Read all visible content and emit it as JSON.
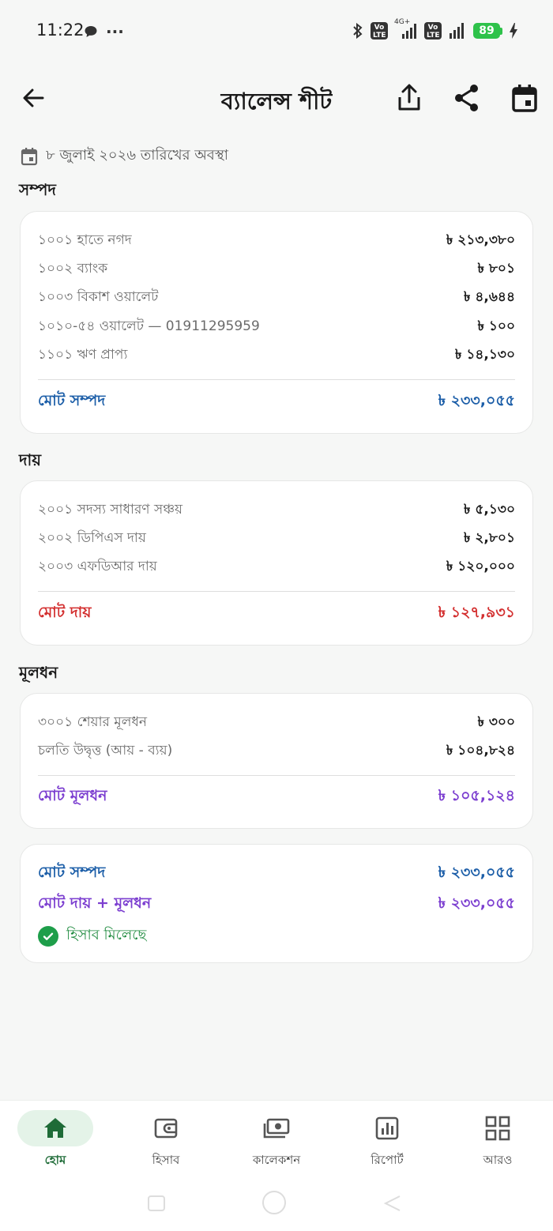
{
  "status_bar": {
    "time": "11:22",
    "dots": "···",
    "network": "4G+",
    "lte1": "Vo LTE",
    "lte2": "Vo LTE",
    "battery": "89"
  },
  "app_bar": {
    "title": "ব্যালেন্স শীট"
  },
  "date_line": "৮ জুলাই ২০২৬ তারিখের অবস্থা",
  "assets": {
    "heading": "সম্পদ",
    "rows": [
      {
        "label": "১০০১ হাতে নগদ",
        "value": "৳ ২১৩,৩৮০"
      },
      {
        "label": "১০০২ ব্যাংক",
        "value": "৳ ৮০১"
      },
      {
        "label": "১০০৩ বিকাশ ওয়ালেট",
        "value": "৳ ৪,৬৪৪"
      },
      {
        "label": "১০১০-৫৪ ওয়ালেট — 01911295959",
        "value": "৳ ১০০"
      },
      {
        "label": "১১০১ ঋণ প্রাপ্য",
        "value": "৳ ১৪,১৩০"
      }
    ],
    "total_label": "মোট সম্পদ",
    "total_value": "৳ ২৩৩,০৫৫"
  },
  "liabilities": {
    "heading": "দায়",
    "rows": [
      {
        "label": "২০০১ সদস্য সাধারণ সঞ্চয়",
        "value": "৳ ৫,১৩০"
      },
      {
        "label": "২০০২ ডিপিএস দায়",
        "value": "৳ ২,৮০১"
      },
      {
        "label": "২০০৩ এফডিআর দায়",
        "value": "৳ ১২০,০০০"
      }
    ],
    "total_label": "মোট দায়",
    "total_value": "৳ ১২৭,৯৩১"
  },
  "equity": {
    "heading": "মূলধন",
    "rows": [
      {
        "label": "৩০০১ শেয়ার মূলধন",
        "value": "৳ ৩০০"
      },
      {
        "label": "চলতি উদ্বৃত্ত (আয় - ব্যয়)",
        "value": "৳ ১০৪,৮২৪"
      }
    ],
    "total_label": "মোট মূলধন",
    "total_value": "৳ ১০৫,১২৪"
  },
  "summary": {
    "assets_label": "মোট সম্পদ",
    "assets_value": "৳ ২৩৩,০৫৫",
    "liab_equity_label": "মোট দায় + মূলধন",
    "liab_equity_value": "৳ ২৩৩,০৫৫",
    "balanced_text": "হিসাব মিলেছে"
  },
  "bottom_nav": [
    {
      "label": "হোম",
      "icon": "home-icon",
      "active": true
    },
    {
      "label": "হিসাব",
      "icon": "wallet-icon",
      "active": false
    },
    {
      "label": "কালেকশন",
      "icon": "cash-icon",
      "active": false
    },
    {
      "label": "রিপোর্ট",
      "icon": "report-icon",
      "active": false
    },
    {
      "label": "আরও",
      "icon": "grid-icon",
      "active": false
    }
  ],
  "colors": {
    "accent_green": "#1e6b37",
    "assets_blue": "#1c5ea8",
    "liability_red": "#d32f2f",
    "equity_purple": "#7c3fd0"
  }
}
